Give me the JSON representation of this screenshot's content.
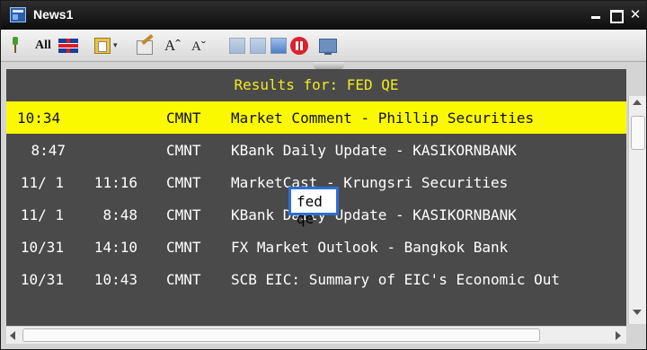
{
  "window": {
    "title": "News1"
  },
  "toolbar": {
    "all_label": "All",
    "font_up_label": "Aˆ",
    "font_down_label": "Aˇ",
    "dropdown_glyph": "▾"
  },
  "results": {
    "header": "Results for: FED QE",
    "rows": [
      {
        "date": "",
        "time": "10:34",
        "source": "CMNT",
        "headline": "Market Comment - Phillip Securities"
      },
      {
        "date": "",
        "time": "8:47",
        "source": "CMNT",
        "headline": "KBank Daily Update - KASIKORNBANK"
      },
      {
        "date": "11/ 1",
        "time": "11:16",
        "source": "CMNT",
        "headline": "MarketCast - Krungsri Securities"
      },
      {
        "date": "11/ 1",
        "time": "8:48",
        "source": "CMNT",
        "headline": "KBank Daily Update - KASIKORNBANK"
      },
      {
        "date": "10/31",
        "time": "14:10",
        "source": "CMNT",
        "headline": "FX Market Outlook - Bangkok Bank"
      },
      {
        "date": "10/31",
        "time": "10:43",
        "source": "CMNT",
        "headline": "SCB EIC: Summary of EIC's Economic Out"
      }
    ]
  },
  "search": {
    "value": "fed qe"
  },
  "icons": {
    "app": "news-window-icon",
    "pin": "pin-icon",
    "flag": "uk-flag-icon",
    "stop": "stop-icon",
    "monitor": "monitor-icon"
  },
  "colors": {
    "selected_row": "#fbf900",
    "header_text": "#f2ea22",
    "background": "#4a4a4a",
    "search_border": "#2c6fd4"
  }
}
